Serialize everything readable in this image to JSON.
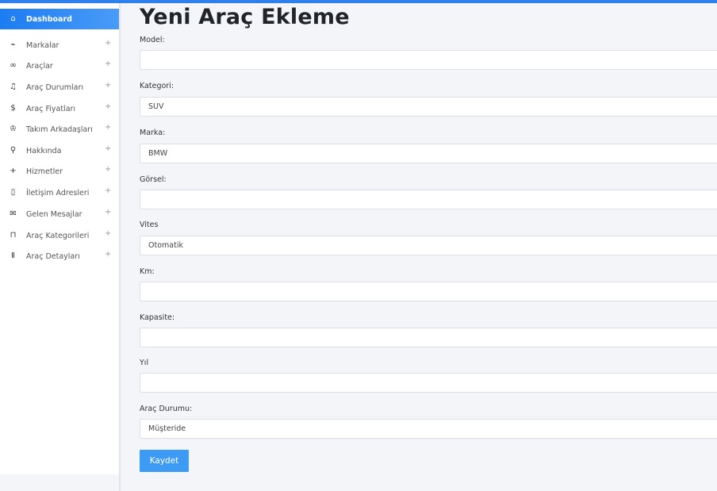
{
  "page": {
    "title": "Yeni Araç Ekleme"
  },
  "sidebar": {
    "active": {
      "label": "Dashboard",
      "icon": "home-icon"
    },
    "items": [
      {
        "label": "Markalar",
        "icon": "activity-icon"
      },
      {
        "label": "Araçlar",
        "icon": "link-icon"
      },
      {
        "label": "Araç Durumları",
        "icon": "music-icon"
      },
      {
        "label": "Araç Fiyatları",
        "icon": "dollar-icon"
      },
      {
        "label": "Takım Arkadaşları",
        "icon": "crown-icon"
      },
      {
        "label": "Hakkında",
        "icon": "search-icon"
      },
      {
        "label": "Hizmetler",
        "icon": "plus-icon"
      },
      {
        "label": "İletişim Adresleri",
        "icon": "bookmark-icon"
      },
      {
        "label": "Gelen Mesajlar",
        "icon": "mail-icon"
      },
      {
        "label": "Araç Kategorileri",
        "icon": "bag-icon"
      },
      {
        "label": "Araç Detayları",
        "icon": "tower-icon"
      }
    ],
    "expand_symbol": "+"
  },
  "form": {
    "model_label": "Model:",
    "model_value": "",
    "kategori_label": "Kategori:",
    "kategori_value": "SUV",
    "marka_label": "Marka:",
    "marka_value": "BMW",
    "gorsel_label": "Görsel:",
    "gorsel_value": "",
    "vites_label": "Vites",
    "vites_value": "Otomatik",
    "km_label": "Km:",
    "km_value": "",
    "kapasite_label": "Kapasite:",
    "kapasite_value": "",
    "yil_label": "Yıl",
    "yil_value": "",
    "durum_label": "Araç Durumu:",
    "durum_value": "Müşteride",
    "submit_label": "Kaydet"
  },
  "colors": {
    "accent": "#2f80ed",
    "button": "#3d9bf4"
  }
}
